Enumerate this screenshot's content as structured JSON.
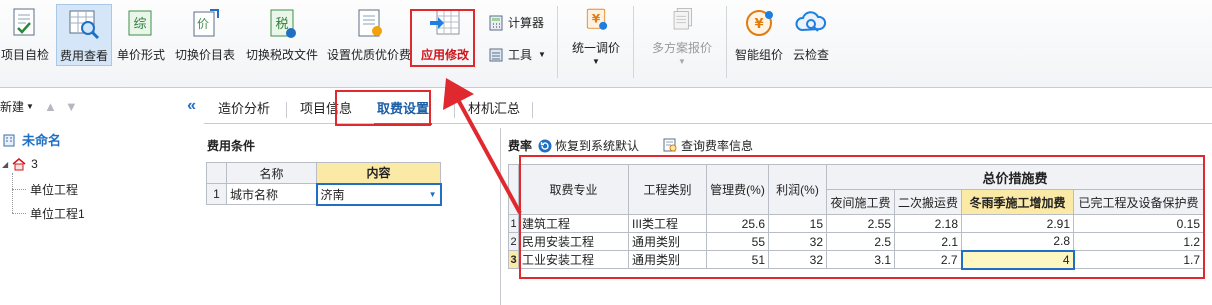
{
  "ribbon": {
    "project_check": "项目自检",
    "fee_view": "费用查看",
    "unit_price_form": "单价形式",
    "switch_price_list": "切换价目表",
    "switch_tax_file": "切换税改文件",
    "set_quality_fee": "设置优质优价费",
    "apply_modify": "应用修改",
    "calculator": "计算器",
    "tools": "工具",
    "unified_adjust": "统一调价",
    "multi_plan_quote": "多方案报价",
    "smart_price": "智能组价",
    "cloud_check": "云检查",
    "fee_icon_text": "价",
    "tax_icon_text": "税",
    "unit_icon_text": "综",
    "yen_icon_text": "¥"
  },
  "tree": {
    "new_label": "新建",
    "root": "未命名",
    "node": "3",
    "children": [
      "单位工程",
      "单位工程1"
    ]
  },
  "tabs": [
    "造价分析",
    "项目信息",
    "取费设置",
    "材机汇总"
  ],
  "cost_conditions": {
    "title": "费用条件",
    "headers": [
      "名称",
      "内容"
    ],
    "rows": [
      {
        "index": "1",
        "name": "城市名称",
        "value": "济南"
      }
    ]
  },
  "rate": {
    "title": "费率",
    "restore_default": "恢复到系统默认",
    "query_rate": "查询费率信息",
    "group_header": "总价措施费",
    "headers": {
      "category": "取费专业",
      "project_type": "工程类别",
      "mgmt_fee": "管理费(%)",
      "profit": "利润(%)",
      "night": "夜间施工费",
      "second_move": "二次搬运费",
      "winter_rain": "冬雨季施工增加费",
      "protect": "已完工程及设备保护费"
    },
    "rows": [
      {
        "index": "1",
        "category": "建筑工程",
        "project_type": "III类工程",
        "mgmt_fee": "25.6",
        "profit": "15",
        "night": "2.55",
        "second_move": "2.18",
        "winter_rain": "2.91",
        "protect": "0.15"
      },
      {
        "index": "2",
        "category": "民用安装工程",
        "project_type": "通用类别",
        "mgmt_fee": "55",
        "profit": "32",
        "night": "2.5",
        "second_move": "2.1",
        "winter_rain": "2.8",
        "protect": "1.2"
      },
      {
        "index": "3",
        "category": "工业安装工程",
        "project_type": "通用类别",
        "mgmt_fee": "51",
        "profit": "32",
        "night": "3.1",
        "second_move": "2.7",
        "winter_rain": "4",
        "protect": "1.7"
      }
    ]
  },
  "colors": {
    "highlight_red": "#e0292f",
    "header_yellow": "#fbe9a6",
    "active_blue": "#2b7dd6"
  }
}
